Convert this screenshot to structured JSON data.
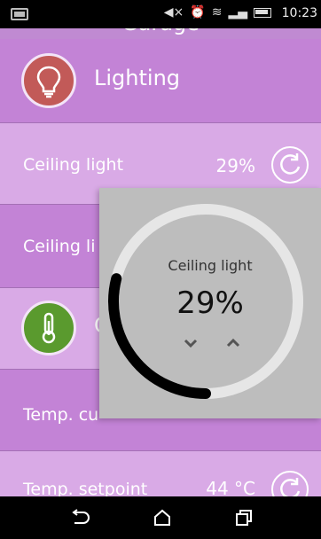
{
  "statusbar": {
    "time": "10:23"
  },
  "page": {
    "title": "Garage"
  },
  "rows": [
    {
      "kind": "header",
      "label": "Lighting",
      "icon": "lightbulb-icon",
      "icon_color": "#c25a58"
    },
    {
      "kind": "item",
      "label": "Ceiling light",
      "value": "29%"
    },
    {
      "kind": "item",
      "label": "Ceiling li",
      "value": ""
    },
    {
      "kind": "header",
      "label": "C",
      "icon": "thermometer-icon",
      "icon_color": "#5a9a2e"
    },
    {
      "kind": "item",
      "label": "Temp. cu",
      "value": ""
    },
    {
      "kind": "item",
      "label": "Temp. setpoint",
      "value": "44 °C"
    }
  ],
  "popup": {
    "title": "Ceiling light",
    "value": "29%",
    "level_fraction": 0.29
  },
  "colors": {
    "dark_row": "#c383d6",
    "light_row": "#d9aae6",
    "popup_bg": "#bdbdbd",
    "dial_track": "#e6e6e6",
    "dial_fill": "#000000"
  }
}
